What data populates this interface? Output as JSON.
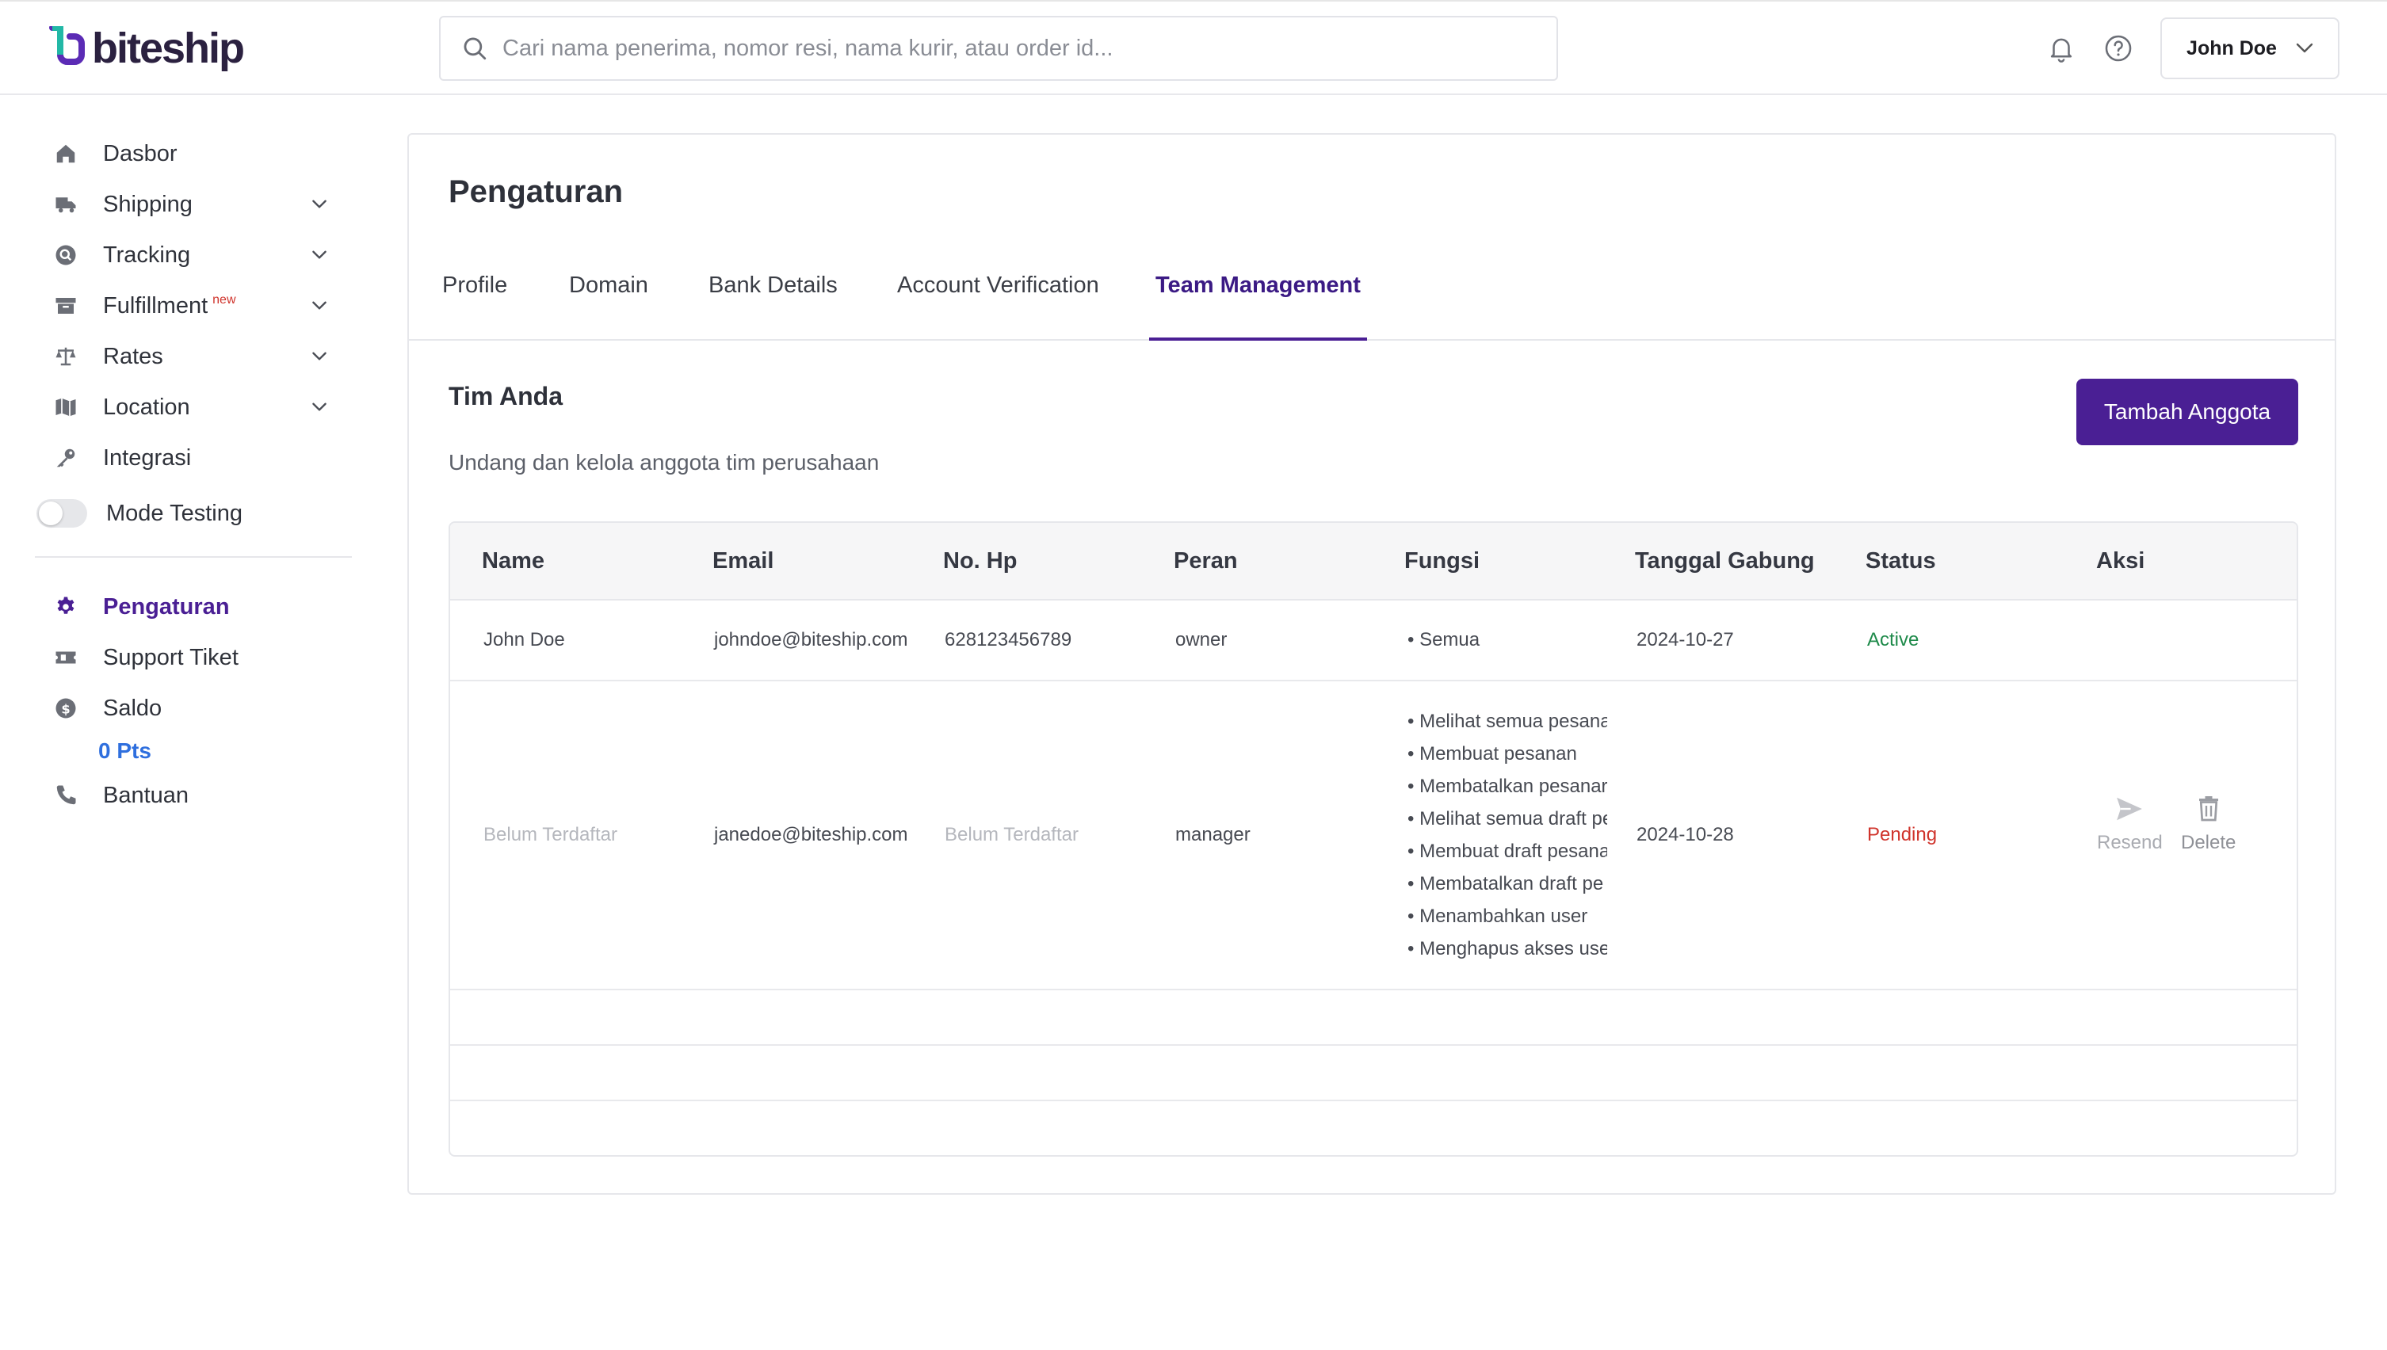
{
  "header": {
    "brand": "biteship",
    "search_placeholder": "Cari nama penerima, nomor resi, nama kurir, atau order id...",
    "user_name": "John Doe"
  },
  "sidebar": {
    "items": [
      {
        "label": "Dasbor"
      },
      {
        "label": "Shipping"
      },
      {
        "label": "Tracking"
      },
      {
        "label": "Fulfillment",
        "badge": "new"
      },
      {
        "label": "Rates"
      },
      {
        "label": "Location"
      },
      {
        "label": "Integrasi"
      },
      {
        "label": "Mode Testing"
      }
    ],
    "bottom_items": [
      {
        "label": "Pengaturan"
      },
      {
        "label": "Support Tiket"
      },
      {
        "label": "Saldo"
      },
      {
        "label": "Bantuan"
      }
    ],
    "saldo_points": "0 Pts"
  },
  "main": {
    "title": "Pengaturan",
    "tabs": [
      {
        "label": "Profile"
      },
      {
        "label": "Domain"
      },
      {
        "label": "Bank Details"
      },
      {
        "label": "Account Verification"
      },
      {
        "label": "Team Management",
        "active": true
      }
    ],
    "section_title": "Tim Anda",
    "section_subtitle": "Undang dan kelola anggota tim perusahaan",
    "add_button": "Tambah Anggota",
    "table": {
      "columns": [
        "Name",
        "Email",
        "No. Hp",
        "Peran",
        "Fungsi",
        "Tanggal Gabung",
        "Status",
        "Aksi"
      ],
      "rows": [
        {
          "name": "John Doe",
          "email": "johndoe@biteship.com",
          "phone": "628123456789",
          "role": "owner",
          "functions": [
            "• Semua"
          ],
          "joined": "2024-10-27",
          "status": "Active"
        },
        {
          "name": "Belum Terdaftar",
          "email": "janedoe@biteship.com",
          "phone": "Belum Terdaftar",
          "role": "manager",
          "functions": [
            "• Melihat semua pesana",
            "• Membuat pesanan",
            "• Membatalkan pesanar",
            "• Melihat semua draft pe",
            "• Membuat draft pesana",
            "• Membatalkan draft pe",
            "• Menambahkan user",
            "• Menghapus akses use"
          ],
          "joined": "2024-10-28",
          "status": "Pending",
          "actions": [
            "Resend",
            "Delete"
          ]
        }
      ]
    }
  },
  "colors": {
    "primary": "#4a1f94",
    "active_status": "#1e8a4a",
    "pending_status": "#d0342c",
    "points": "#2f6fde"
  }
}
